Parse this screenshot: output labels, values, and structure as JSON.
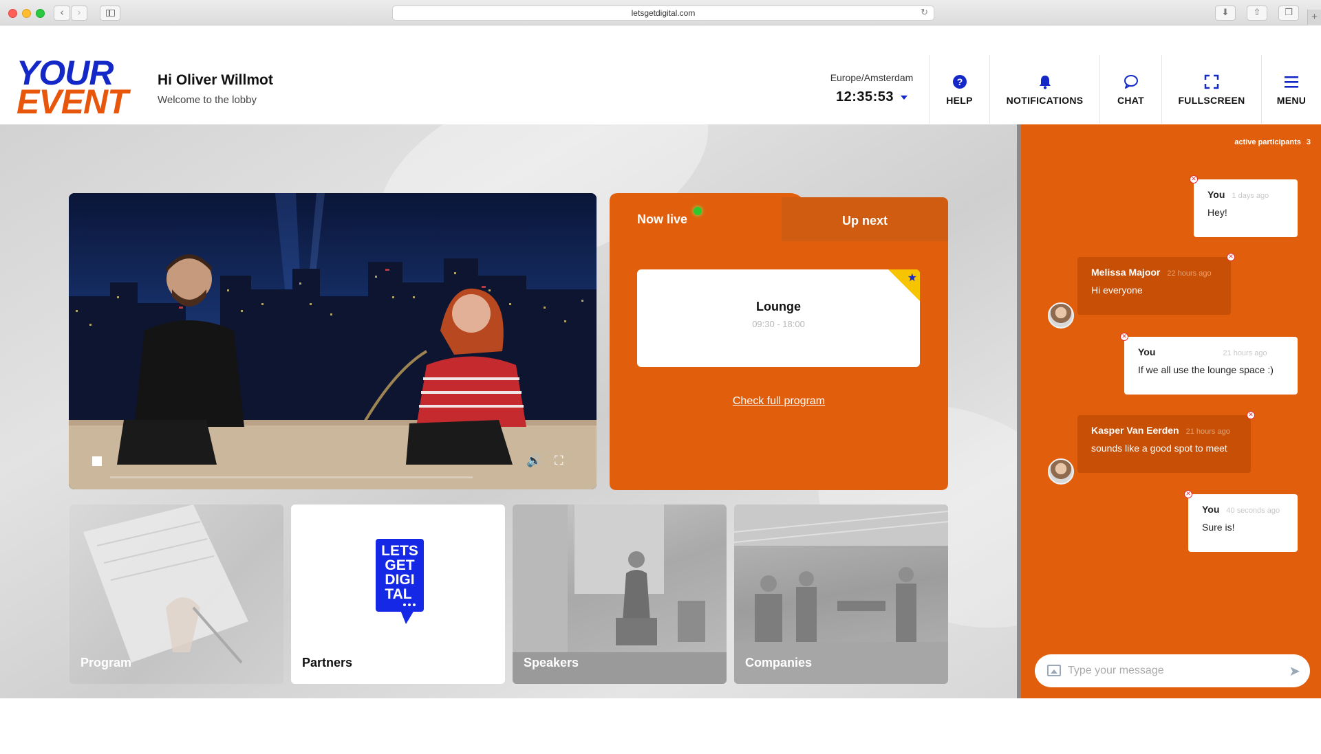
{
  "browser": {
    "url": "letsgetdigital.com"
  },
  "header": {
    "logo_line1": "YOUR",
    "logo_line2": "EVENT",
    "greeting": "Hi Oliver Willmot",
    "subtitle": "Welcome to the lobby",
    "timezone": "Europe/Amsterdam",
    "time": "12:35:53",
    "nav": {
      "help": "HELP",
      "notifications": "NOTIFICATIONS",
      "chat": "CHAT",
      "fullscreen": "FULLSCREEN",
      "menu": "MENU"
    }
  },
  "live": {
    "tab_now": "Now live",
    "tab_next": "Up next",
    "session_title": "Lounge",
    "session_time": "09:30 - 18:00",
    "program_link": "Check full program"
  },
  "tiles": {
    "program": "Program",
    "partners": "Partners",
    "speakers": "Speakers",
    "companies": "Companies",
    "partners_logo": [
      "LETS",
      "GET",
      "DIGI",
      "TAL"
    ]
  },
  "chat": {
    "participants_label": "active participants",
    "participants_count": "3",
    "messages": [
      {
        "author": "You",
        "time": "1 days ago",
        "text": "Hey!"
      },
      {
        "author": "Melissa Majoor",
        "time": "22 hours ago",
        "text": "Hi everyone"
      },
      {
        "author": "You",
        "time": "21 hours ago",
        "text": "If we all use the lounge space :)"
      },
      {
        "author": "Kasper Van Eerden",
        "time": "21 hours ago",
        "text": "sounds like a good spot to meet"
      },
      {
        "author": "You",
        "time": "40 seconds ago",
        "text": "Sure is!"
      }
    ],
    "input_placeholder": "Type your message"
  },
  "colors": {
    "brand_blue": "#1428c8",
    "brand_orange": "#e15f0c",
    "live_green": "#2ec92e",
    "star_yellow": "#f6c400"
  }
}
